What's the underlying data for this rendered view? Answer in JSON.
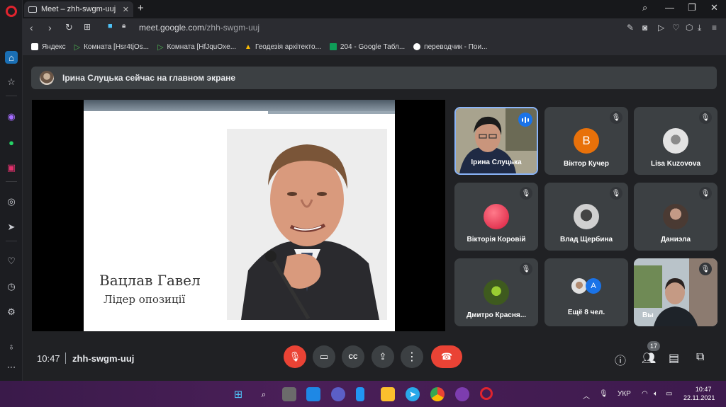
{
  "browser": {
    "tab_title": "Meet – zhh-swgm-uuj",
    "new_tab": "+",
    "url_host": "meet.google.com",
    "url_path": "/zhh-swgm-uuj",
    "bookmarks": [
      {
        "label": "Яндекс",
        "icon": "yandex-icon",
        "color": "#ffffff"
      },
      {
        "label": "Комната [Hsr4tjOs...",
        "icon": "play-icon",
        "color": "#4caf50"
      },
      {
        "label": "Комната [HfJquOxe...",
        "icon": "play-icon",
        "color": "#4caf50"
      },
      {
        "label": "Геодезія архітекто...",
        "icon": "drive-icon",
        "color": "#fbbc04"
      },
      {
        "label": "204 - Google Табл...",
        "icon": "sheets-icon",
        "color": "#0f9d58"
      },
      {
        "label": "переводчик - Пои...",
        "icon": "google-icon",
        "color": "#ffffff"
      }
    ]
  },
  "meet": {
    "banner_text": "Ірина Слуцька сейчас на главном экране",
    "slide": {
      "title": "Вацлав Гавел",
      "subtitle": "Лідер опозиції"
    },
    "participants": [
      {
        "name": "Ірина Слуцька",
        "type": "video",
        "speaking": true
      },
      {
        "name": "Віктор Кучер",
        "type": "letter",
        "letter": "B",
        "color": "#e8710a"
      },
      {
        "name": "Lisa Kuzovova",
        "type": "photo",
        "color": "#d8d8d8"
      },
      {
        "name": "Вікторія Коровій",
        "type": "photo",
        "color": "#e84050"
      },
      {
        "name": "Влад Щербина",
        "type": "photo",
        "color": "#bfbfbf"
      },
      {
        "name": "Даниэла",
        "type": "photo",
        "color": "#6d5c54"
      },
      {
        "name": "Дмитро Красня...",
        "type": "photo",
        "color": "#5a7a30"
      },
      {
        "name": "Ещё 8 чел.",
        "type": "more",
        "letter": "A"
      },
      {
        "name": "Вы",
        "type": "video",
        "speaking": false
      }
    ],
    "time": "10:47",
    "meeting_code": "zhh-swgm-uuj",
    "participant_count": "17"
  },
  "taskbar": {
    "lang": "УКР",
    "time": "10:47",
    "date": "22.11.2021"
  }
}
